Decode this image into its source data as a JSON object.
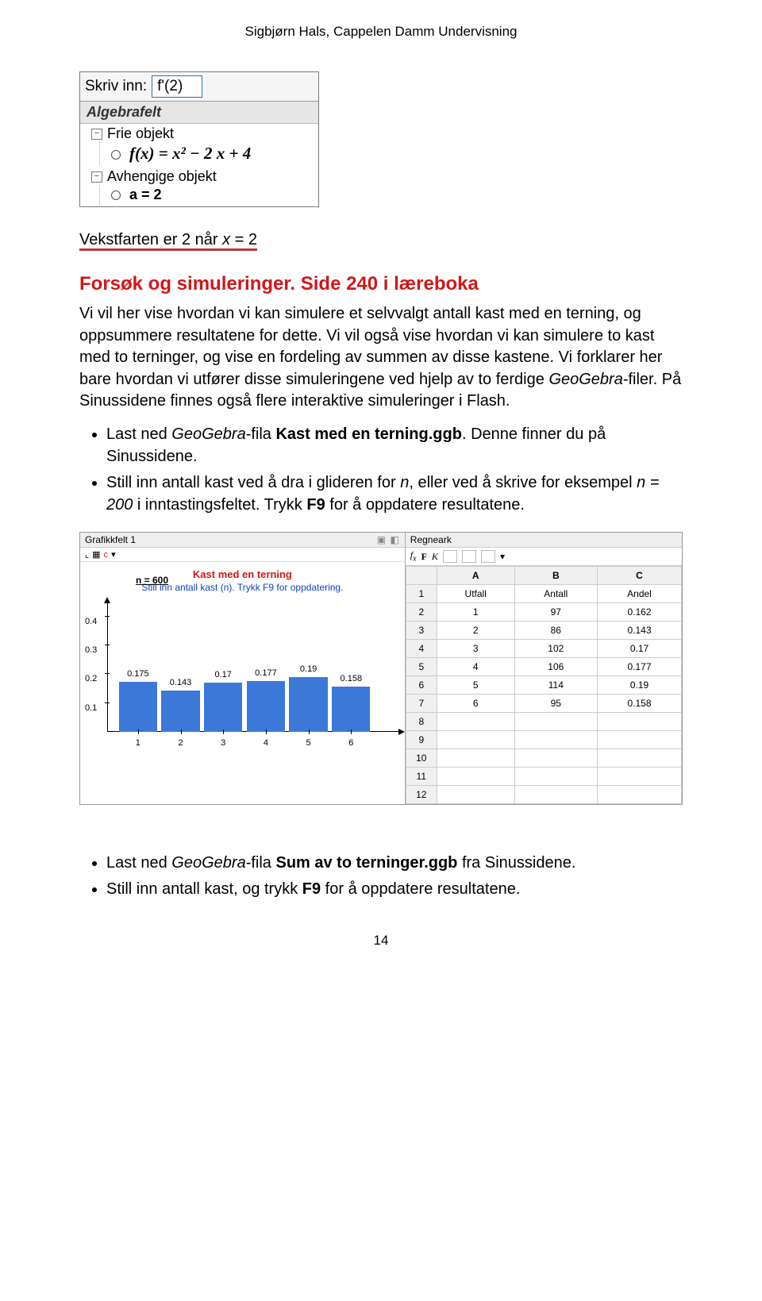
{
  "header": {
    "author": "Sigbjørn Hals, Cappelen Damm Undervisning"
  },
  "algebra_panel": {
    "input_label": "Skriv inn:",
    "input_value": "f'(2)",
    "panel_title": "Algebrafelt",
    "section_free": "Frie objekt",
    "fx_expr": "f(x) = x² − 2 x + 4",
    "section_dep": "Avhengige objekt",
    "dep_value": "a = 2"
  },
  "caption": "Vekstfarten er 2 når x = 2",
  "section_heading": "Forsøk og simuleringer. Side 240 i læreboka",
  "para1": "Vi vil her vise hvordan vi kan simulere et selvvalgt antall kast med en terning, og oppsummere resultatene for dette. Vi vil også vise hvordan vi kan simulere to kast med to terninger, og vise en fordeling av summen av disse kastene. Vi forklarer her bare hvordan vi utfører disse simuleringene ved hjelp av to ferdige GeoGebra-filer. På Sinussidene finnes også flere interaktive simuleringer i Flash.",
  "bullet1_a": "Last ned ",
  "bullet1_b": "GeoGebra",
  "bullet1_c": "-fila ",
  "bullet1_d": "Kast med en terning.ggb",
  "bullet1_e": ". Denne finner du på Sinussidene.",
  "bullet2_a": "Still inn antall kast ved å dra i glideren for ",
  "bullet2_b": "n",
  "bullet2_c": ", eller ved å skrive for eksempel ",
  "bullet2_d": "n = 200",
  "bullet2_e": " i inntastingsfeltet. Trykk ",
  "bullet2_f": "F9",
  "bullet2_g": " for å oppdatere resultatene.",
  "sim": {
    "left_title": "Grafikkfelt 1",
    "n_label": "n = 600",
    "chart_title": "Kast med en terning",
    "chart_sub": "Still inn antall kast (n). Trykk F9 for oppdatering.",
    "right_title": "Regneark",
    "toolbar": "f_x   F  K",
    "columns": [
      "A",
      "B",
      "C"
    ],
    "headers": [
      "Utfall",
      "Antall",
      "Andel"
    ],
    "rows": [
      [
        "1",
        "97",
        "0.162"
      ],
      [
        "2",
        "86",
        "0.143"
      ],
      [
        "3",
        "102",
        "0.17"
      ],
      [
        "4",
        "106",
        "0.177"
      ],
      [
        "5",
        "114",
        "0.19"
      ],
      [
        "6",
        "95",
        "0.158"
      ]
    ]
  },
  "chart_data": {
    "type": "bar",
    "title": "Kast med en terning",
    "categories": [
      1,
      2,
      3,
      4,
      5,
      6
    ],
    "values": [
      0.175,
      0.143,
      0.17,
      0.177,
      0.19,
      0.158
    ],
    "xlabel": "",
    "ylabel": "",
    "yticks": [
      0.1,
      0.2,
      0.3,
      0.4
    ],
    "xlim": [
      0,
      6.5
    ],
    "ylim": [
      0,
      0.45
    ]
  },
  "bullet3_a": "Last ned ",
  "bullet3_b": "GeoGebra",
  "bullet3_c": "-fila ",
  "bullet3_d": "Sum av to terninger.ggb",
  "bullet3_e": " fra Sinussidene.",
  "bullet4_a": "Still inn antall kast, og trykk ",
  "bullet4_b": "F9",
  "bullet4_c": " for å oppdatere resultatene.",
  "page_number": "14"
}
